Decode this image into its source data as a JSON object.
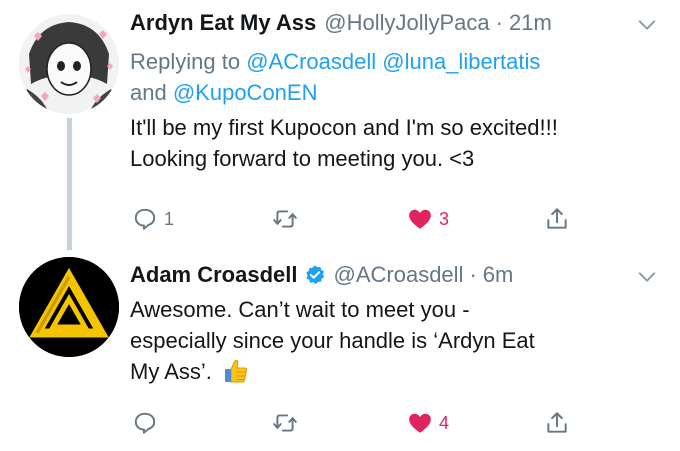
{
  "tweets": [
    {
      "display_name": "Ardyn Eat My Ass",
      "handle": "@HollyJollyPaca",
      "separator": "·",
      "time": "21m",
      "replying_prefix": "Replying to",
      "replying_to_1": "@ACroasdell",
      "replying_to_2": "@luna_libertatis",
      "replying_and": "and",
      "replying_to_3": "@KupoConEN",
      "text_line1": "It'll be my first Kupocon and I'm so excited!!!",
      "text_line2": "Looking forward to meeting you. <3",
      "reply_count": "1",
      "retweet_count": "",
      "like_count": "3",
      "liked": true,
      "avatar_icon": "manga-character-avatar"
    },
    {
      "display_name": "Adam Croasdell",
      "verified": true,
      "handle": "@ACroasdell",
      "separator": "·",
      "time": "6m",
      "text_line1": "Awesome. Can’t wait to meet you -",
      "text_line2": "especially since your handle is ‘Ardyn Eat",
      "text_line3": "My Ass’.",
      "emoji": "thumbs-up-emoji",
      "reply_count": "",
      "retweet_count": "",
      "like_count": "4",
      "liked": true,
      "avatar_icon": "gold-triangle-logo"
    }
  ],
  "colors": {
    "name": "#14171a",
    "meta": "#657786",
    "link": "#1da1f2",
    "like": "#e0245e",
    "thread_line": "#c6d3dd",
    "verified": "#1da1f2"
  }
}
